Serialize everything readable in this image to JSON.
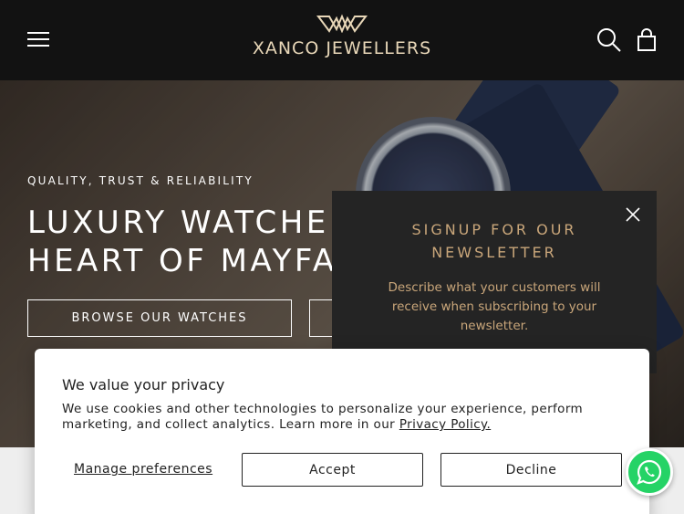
{
  "header": {
    "brand": "XANCO JEWELLERS",
    "menu_icon": "hamburger-menu-icon",
    "search_icon": "search-icon",
    "cart_icon": "shopping-bag-icon",
    "logo_icon": "diamond-logo-icon",
    "brand_color": "#e8d7b8"
  },
  "hero": {
    "tagline": "QUALITY, TRUST & RELIABILITY",
    "headline_line1": "LUXURY WATCHE",
    "headline_line2": "HEART OF MAYFA",
    "browse_button": "BROWSE OUR WATCHES"
  },
  "newsletter": {
    "title": "SIGNUP FOR OUR NEWSLETTER",
    "description": "Describe what your customers will receive when subscribing to your newsletter.",
    "close_icon": "close-icon",
    "accent_color": "#c9a67a"
  },
  "cookie_banner": {
    "title": "We value your privacy",
    "text": "We use cookies and other technologies to personalize your experience, perform marketing, and collect analytics. Learn more in our ",
    "policy_link": "Privacy Policy.",
    "manage_label": "Manage preferences",
    "accept_label": "Accept",
    "decline_label": "Decline"
  },
  "whatsapp": {
    "icon": "whatsapp-icon",
    "color": "#25d366"
  }
}
